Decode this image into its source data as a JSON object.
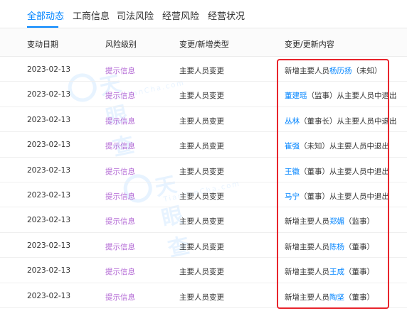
{
  "tabs": [
    {
      "label": "全部动态",
      "active": true
    },
    {
      "label": "工商信息",
      "active": false
    },
    {
      "label": "司法风险",
      "active": false
    },
    {
      "label": "经营风险",
      "active": false
    },
    {
      "label": "经营状况",
      "active": false
    }
  ],
  "columns": {
    "date": "变动日期",
    "level": "风险级别",
    "type": "变更/新增类型",
    "content": "变更/更新内容"
  },
  "rows": [
    {
      "date": "2023-02-13",
      "level": "提示信息",
      "type": "主要人员变更",
      "prefix": "新增主要人员",
      "name": "杨历扬",
      "suffix": "（未知）"
    },
    {
      "date": "2023-02-13",
      "level": "提示信息",
      "type": "主要人员变更",
      "prefix": "",
      "name": "董建瑶",
      "suffix": "（监事）从主要人员中退出"
    },
    {
      "date": "2023-02-13",
      "level": "提示信息",
      "type": "主要人员变更",
      "prefix": "",
      "name": "丛林",
      "suffix": "（董事长）从主要人员中退出"
    },
    {
      "date": "2023-02-13",
      "level": "提示信息",
      "type": "主要人员变更",
      "prefix": "",
      "name": "崔强",
      "suffix": "（未知）从主要人员中退出"
    },
    {
      "date": "2023-02-13",
      "level": "提示信息",
      "type": "主要人员变更",
      "prefix": "",
      "name": "王徽",
      "suffix": "（董事）从主要人员中退出"
    },
    {
      "date": "2023-02-13",
      "level": "提示信息",
      "type": "主要人员变更",
      "prefix": "",
      "name": "马宁",
      "suffix": "（董事）从主要人员中退出"
    },
    {
      "date": "2023-02-13",
      "level": "提示信息",
      "type": "主要人员变更",
      "prefix": "新增主要人员",
      "name": "郑媚",
      "suffix": "（监事）"
    },
    {
      "date": "2023-02-13",
      "level": "提示信息",
      "type": "主要人员变更",
      "prefix": "新增主要人员",
      "name": "陈杨",
      "suffix": "（董事）"
    },
    {
      "date": "2023-02-13",
      "level": "提示信息",
      "type": "主要人员变更",
      "prefix": "新增主要人员",
      "name": "王成",
      "suffix": "（董事）"
    },
    {
      "date": "2023-02-13",
      "level": "提示信息",
      "type": "主要人员变更",
      "prefix": "新增主要人员",
      "name": "陶坚",
      "suffix": "（董事）"
    }
  ],
  "watermark": {
    "brand": "天眼查",
    "sub": "TianYanCha.com"
  },
  "colors": {
    "accent": "#0084ff",
    "level": "#b266d4",
    "highlight": "#e8242c"
  }
}
